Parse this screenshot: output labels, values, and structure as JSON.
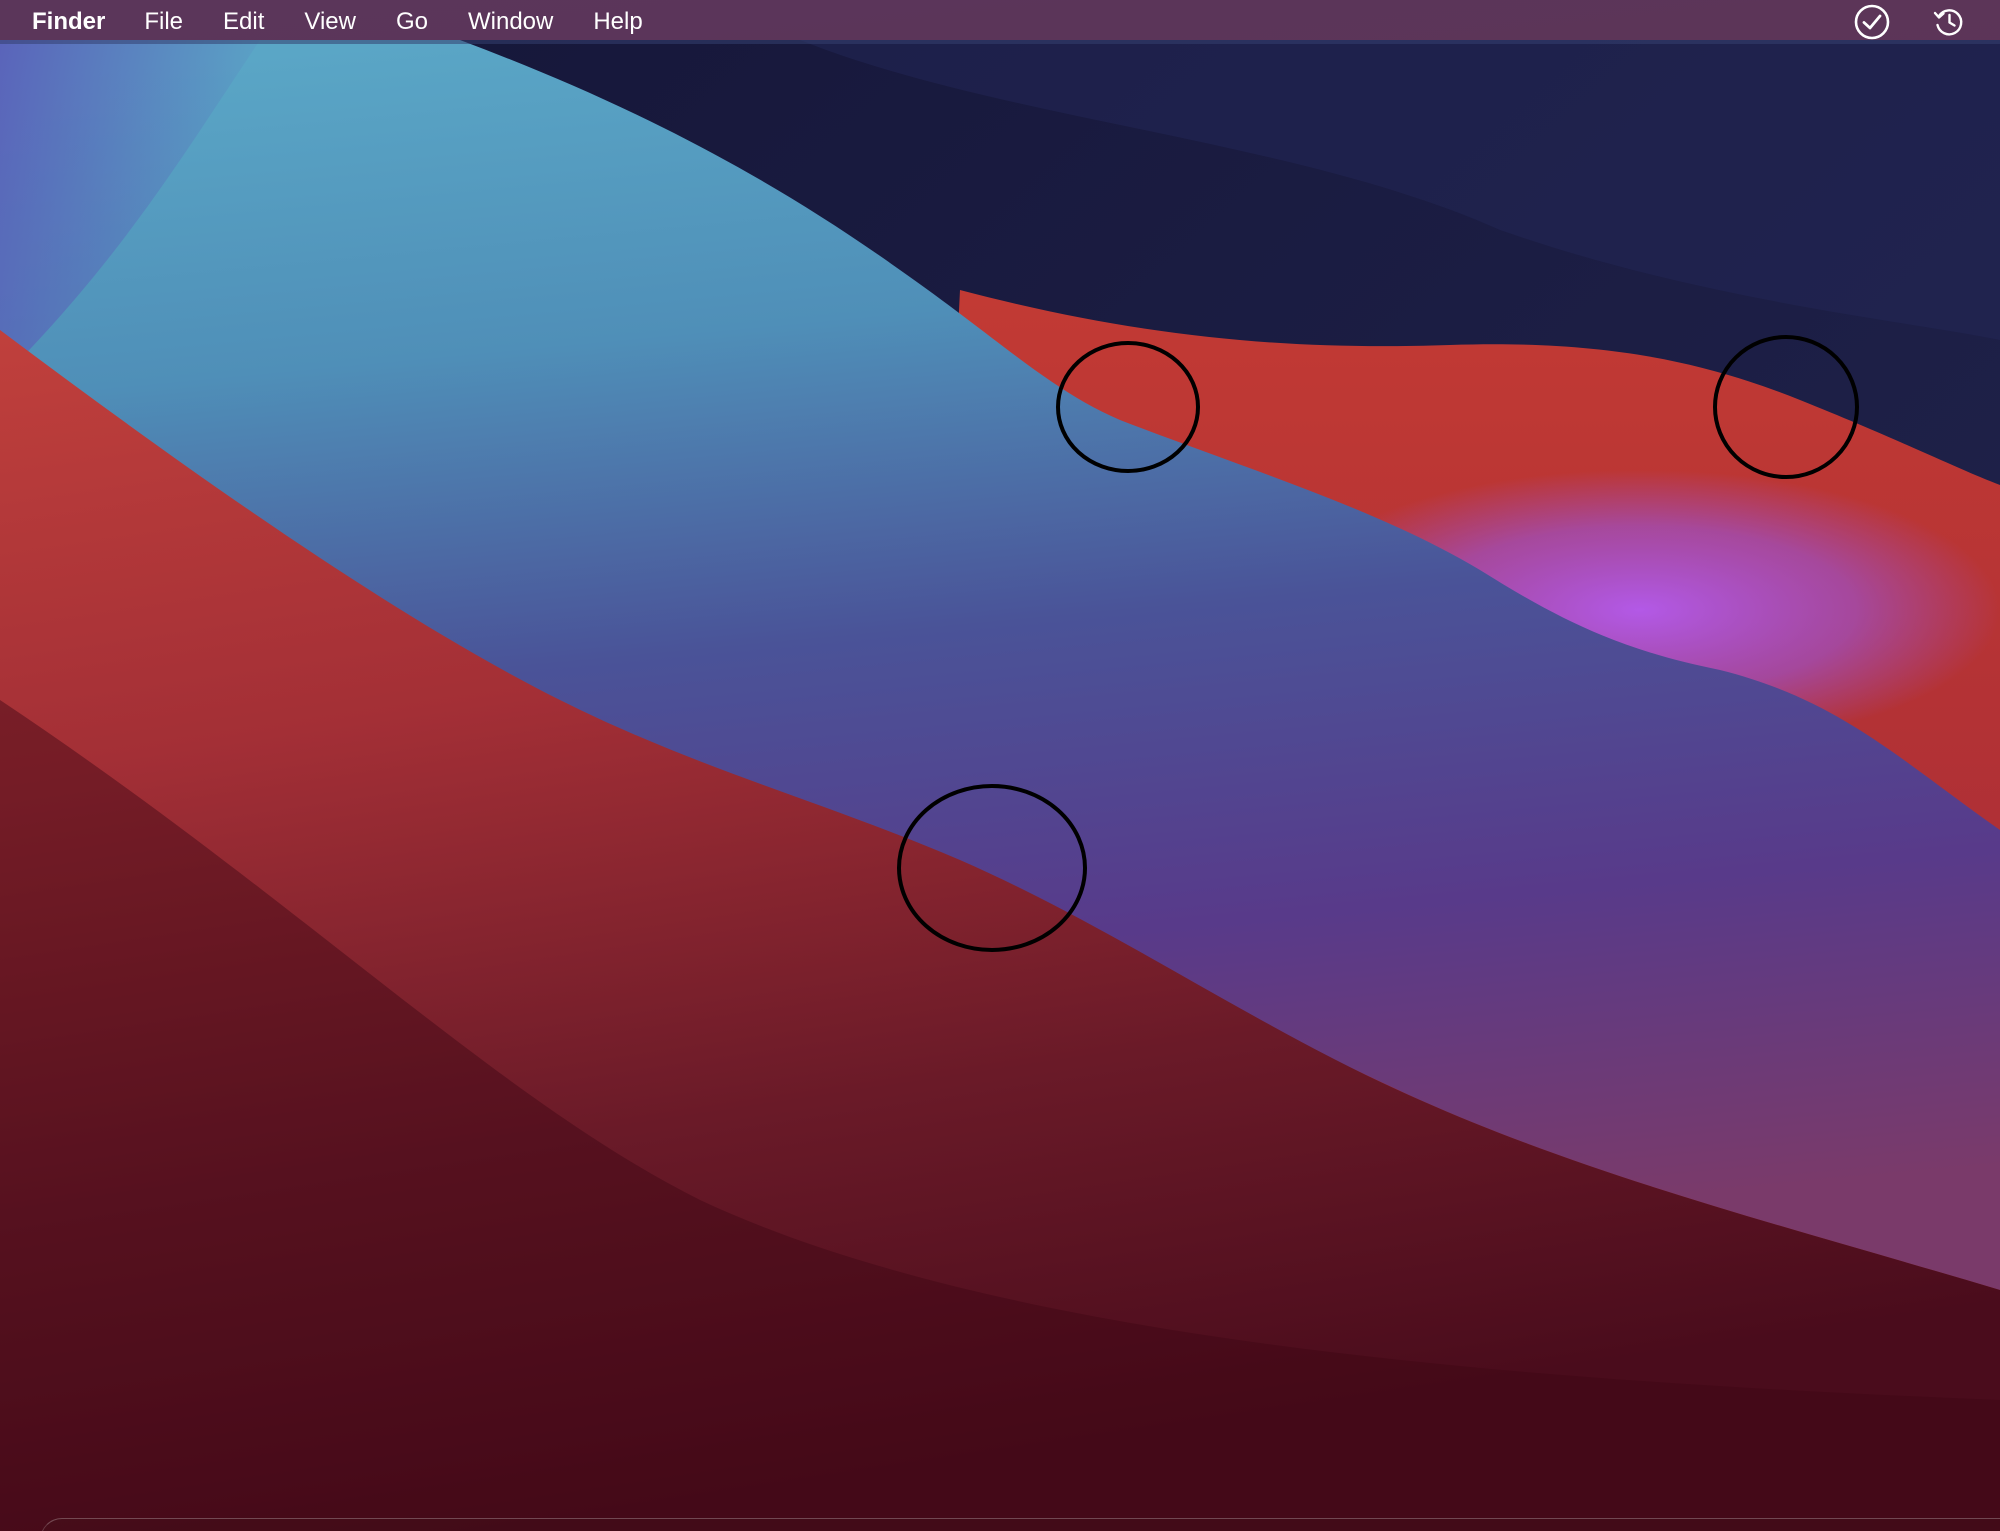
{
  "menubar": {
    "app_name": "Finder",
    "menus": [
      "File",
      "Edit",
      "View",
      "Go",
      "Window",
      "Help"
    ],
    "status_icons": [
      "checkmark-circle-icon",
      "time-machine-icon"
    ]
  },
  "desktop": {
    "wallpaper": "macOS Big Sur",
    "annotation_marks": 3,
    "annotation_color": "#000000"
  },
  "colors": {
    "menubar_text": "#ffffff",
    "wallpaper_navy": "#1b1c3f",
    "wallpaper_blue": "#579fc3",
    "wallpaper_purple": "#4f4190",
    "wallpaper_red": "#b83a37",
    "wallpaper_dark_red": "#4a0c18",
    "wallpaper_violet": "#9a55e0"
  }
}
